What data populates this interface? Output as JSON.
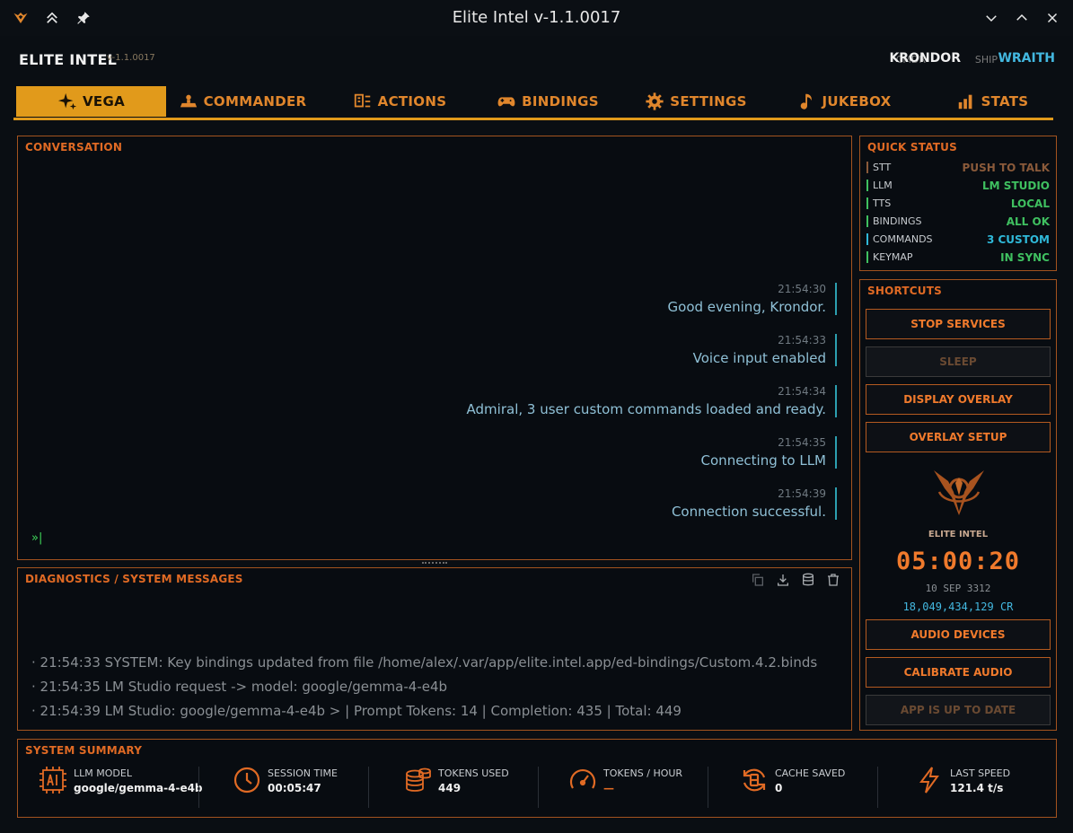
{
  "window": {
    "title": "Elite Intel v-1.1.0017"
  },
  "header": {
    "app_name": "ELITE INTEL",
    "version": "v-1.1.0017",
    "cmdr_label": "CMDR",
    "cmdr_value": "KRONDOR",
    "ship_label": "SHIP",
    "ship_value": "WRAITH"
  },
  "tabs": [
    {
      "label": "VEGA",
      "icon": "sparkle-icon",
      "active": true
    },
    {
      "label": "COMMANDER",
      "icon": "commander-icon",
      "active": false
    },
    {
      "label": "ACTIONS",
      "icon": "actions-icon",
      "active": false
    },
    {
      "label": "BINDINGS",
      "icon": "gamepad-icon",
      "active": false
    },
    {
      "label": "SETTINGS",
      "icon": "gear-icon",
      "active": false
    },
    {
      "label": "JUKEBOX",
      "icon": "music-note-icon",
      "active": false
    },
    {
      "label": "STATS",
      "icon": "bar-chart-icon",
      "active": false
    }
  ],
  "conversation": {
    "title": "CONVERSATION",
    "messages": [
      {
        "time": "21:54:30",
        "text": "Good evening, Krondor."
      },
      {
        "time": "21:54:33",
        "text": "Voice input enabled"
      },
      {
        "time": "21:54:34",
        "text": "Admiral, 3 user custom commands loaded and ready."
      },
      {
        "time": "21:54:35",
        "text": "Connecting to LLM"
      },
      {
        "time": "21:54:39",
        "text": "Connection successful."
      }
    ],
    "prompt": "»|"
  },
  "diagnostics": {
    "title": "DIAGNOSTICS / SYSTEM MESSAGES",
    "lines": [
      "· 21:54:33  SYSTEM: Key bindings updated from file /home/alex/.var/app/elite.intel.app/ed-bindings/Custom.4.2.binds",
      "· 21:54:35  LM Studio request -> model: google/gemma-4-e4b",
      "· 21:54:39  LM Studio: google/gemma-4-e4b > | Prompt Tokens: 14 | Completion: 435 | Total: 449"
    ]
  },
  "quick_status": {
    "title": "QUICK STATUS",
    "rows": [
      {
        "key": "STT",
        "value": "PUSH TO TALK",
        "color": "#8a5a3a"
      },
      {
        "key": "LLM",
        "value": "LM STUDIO",
        "color": "#3fc060"
      },
      {
        "key": "TTS",
        "value": "LOCAL",
        "color": "#3fc060"
      },
      {
        "key": "BINDINGS",
        "value": "ALL OK",
        "color": "#3fc060"
      },
      {
        "key": "COMMANDS",
        "value": "3 CUSTOM",
        "color": "#2fb8d8"
      },
      {
        "key": "KEYMAP",
        "value": "IN SYNC",
        "color": "#3fc060"
      }
    ]
  },
  "shortcuts": {
    "title": "SHORTCUTS",
    "stop_services": "STOP SERVICES",
    "sleep": "SLEEP",
    "display_overlay": "DISPLAY OVERLAY",
    "overlay_setup": "OVERLAY SETUP",
    "logo_label": "ELITE INTEL",
    "clock": "05:00:20",
    "date": "10 SEP 3312",
    "credits": "18,049,434,129 CR",
    "audio_devices": "AUDIO DEVICES",
    "calibrate_audio": "CALIBRATE AUDIO",
    "app_status": "APP IS UP TO DATE"
  },
  "summary": {
    "title": "SYSTEM SUMMARY",
    "items": [
      {
        "label": "LLM MODEL",
        "value": "google/gemma-4-e4b",
        "icon": "ai-chip-icon"
      },
      {
        "label": "SESSION TIME",
        "value": "00:05:47",
        "icon": "clock-icon"
      },
      {
        "label": "TOKENS USED",
        "value": "449",
        "icon": "coins-icon"
      },
      {
        "label": "TOKENS / HOUR",
        "value": "—",
        "icon": "gauge-icon"
      },
      {
        "label": "CACHE SAVED",
        "value": "0",
        "icon": "cache-icon"
      },
      {
        "label": "LAST SPEED",
        "value": "121.4 t/s",
        "icon": "lightning-icon"
      }
    ]
  },
  "colors": {
    "accent": "#e19a1b",
    "orange": "#e06a24",
    "cyan": "#43b8e0",
    "green": "#3fc060"
  }
}
